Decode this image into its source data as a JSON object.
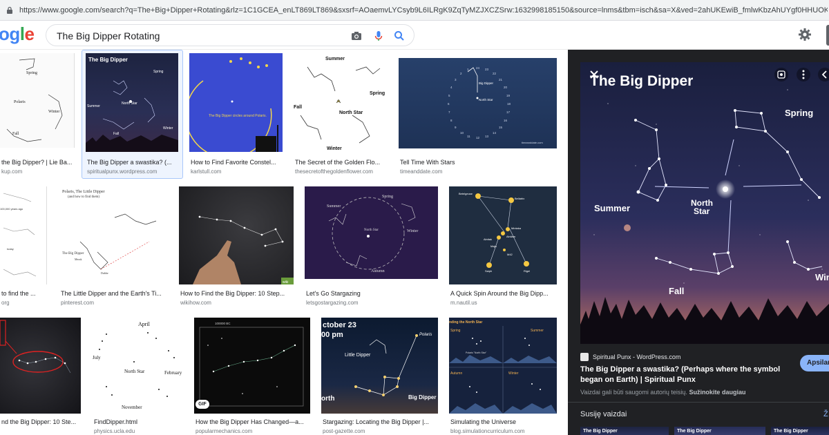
{
  "browser": {
    "url": "https://www.google.com/search?q=The+Big+Dipper+Rotating&rlz=1C1GCEA_enLT869LT869&sxsrf=AOaemvLYCsyb9L6ILRgK9ZqTyMZJXCZSrw:1632998185150&source=lnms&tbm=isch&sa=X&ved=2ahUKEwiB_fmlwKbzAhUYgf0HHUOKCqIQ_AUoAXoECAEQ..."
  },
  "header": {
    "logo": [
      "o",
      "g",
      "l",
      "e"
    ],
    "search_value": "The Big Dipper Rotating"
  },
  "results": [
    {
      "title": "the Big Dipper? | Lie Ba...",
      "source": "kup.com",
      "labels": [
        "Spring",
        "Polaris",
        "Winter",
        "Fall"
      ]
    },
    {
      "title": "The Big Dipper a swastika? (...",
      "source": "spiritualpunx.wordpress.com",
      "labels": [
        "The Big Dipper",
        "Spring",
        "Summer",
        "North Star",
        "Fall",
        "Winter"
      ]
    },
    {
      "title": "How to Find Favorite Constel...",
      "source": "karlstull.com",
      "labels": [
        "The Big Dipper circles around Polaris."
      ]
    },
    {
      "title": "The Secret of the Golden Flo...",
      "source": "thesecretofthegoldenflower.com",
      "labels": [
        "Summer",
        "Spring",
        "North Star",
        "Winter",
        "Fall"
      ]
    },
    {
      "title": "Tell Time With Stars",
      "source": "timeanddate.com",
      "labels": [
        "Big Dipper",
        "North Star",
        "24",
        "23",
        "22",
        "21",
        "20",
        "19",
        "18",
        "17",
        "16",
        "15",
        "14",
        "13",
        "12",
        "11",
        "10",
        "9",
        "8",
        "7",
        "6",
        "5",
        "4",
        "3",
        "2",
        "1",
        "timeanddate.com"
      ]
    },
    {
      "title": "to find the ...",
      "source": "org",
      "labels": [
        "100,000 years ago",
        "today"
      ]
    },
    {
      "title": "The Little Dipper and the Earth's Ti...",
      "source": "pinterest.com",
      "labels": [
        "Polaris, The Little Dipper",
        "(and how to find them)",
        "The Big Dipper",
        "Dubhe",
        "Merak"
      ]
    },
    {
      "title": "How to Find the Big Dipper: 10 Step...",
      "source": "wikihow.com",
      "labels": [
        "wiki"
      ]
    },
    {
      "title": "Let's Go Stargazing",
      "source": "letsgostargazing.com",
      "labels": [
        "Summer",
        "Spring",
        "North Star",
        "Winter",
        "Autumn"
      ]
    },
    {
      "title": "A Quick Spin Around the Big Dipp...",
      "source": "m.nautil.us",
      "labels": [
        "Betelgeuse",
        "Bellatrix",
        "Mintaka",
        "Alnilam",
        "Alnitak",
        "Saiph",
        "Rigel",
        "Maja",
        "M42"
      ]
    },
    {
      "title": "nd the Big Dipper: 10 Ste...",
      "source": "",
      "labels": []
    },
    {
      "title": "FindDipper.html",
      "source": "physics.ucla.edu",
      "labels": [
        "April",
        "July",
        "North Star",
        "February",
        "November"
      ]
    },
    {
      "title": "How the Big Dipper Has Changed—a...",
      "source": "popularmechanics.com",
      "labels": [
        "GIF",
        "100000 BC"
      ]
    },
    {
      "title": "Stargazing: Locating the Big Dipper |...",
      "source": "post-gazette.com",
      "labels": [
        "ctober 23",
        "00 pm",
        "Polaris",
        "Little Dipper",
        "Big Dipper",
        "orth"
      ]
    },
    {
      "title": "Simulating the Universe",
      "source": "blog.simulationcurriculum.com",
      "labels": [
        "nding the North Star",
        "Spring",
        "Summer",
        "Autumn",
        "Winter",
        "Polaris \"North Star\""
      ]
    }
  ],
  "panel": {
    "image_labels": {
      "title": "The Big Dipper",
      "spring": "Spring",
      "summer": "Summer",
      "north": "North",
      "star": "Star",
      "fall": "Fall",
      "winter": "Win"
    },
    "source_name": "Spiritual Punx - WordPress.com",
    "title": "The Big Dipper a swastika? (Perhaps where the symbol began on Earth) | Spiritual Punx",
    "visit_button": "Apsilan",
    "copyright_text": "Vaizdai gali būti saugomi autorių teisių.",
    "copyright_link": "Sužinokite daugiau",
    "related_label": "Susiję vaizdai",
    "related_more": "Ž",
    "related_thumbs": [
      "The Big Dipper",
      "The Big Dipper",
      "The Big Dipper"
    ]
  },
  "colors": {
    "accent": "#8ab4f8",
    "panel_bg": "#202124",
    "selected_bg": "#eef4fe"
  }
}
